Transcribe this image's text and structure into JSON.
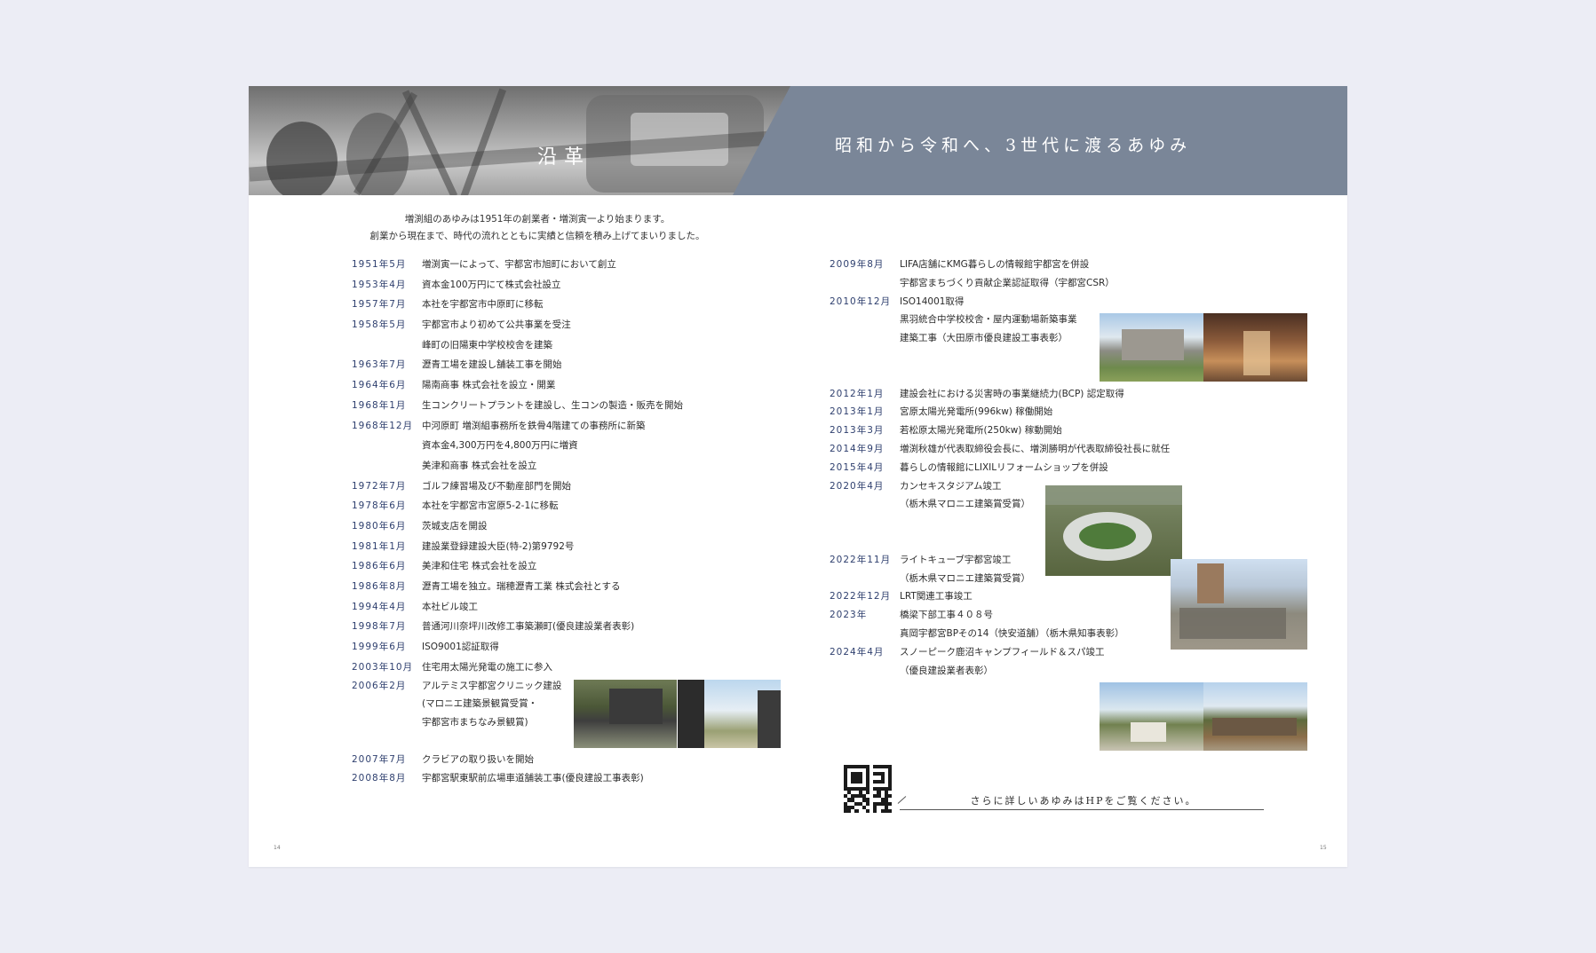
{
  "header": {
    "section_title": "沿革",
    "tagline": "昭和から令和へ、3世代に渡るあゆみ"
  },
  "intro": {
    "line1": "増渕組のあゆみは1951年の創業者・増渕寅一より始まります。",
    "line2": "創業から現在まで、時代の流れとともに実績と信頼を積み上げてまいりました。"
  },
  "left_timeline": [
    {
      "date": "1951年5月",
      "text": "増渕寅一によって、宇都宮市旭町において創立"
    },
    {
      "date": "1953年4月",
      "text": "資本金100万円にて株式会社設立"
    },
    {
      "date": "1957年7月",
      "text": "本社を宇都宮市中原町に移転"
    },
    {
      "date": "1958年5月",
      "text": "宇都宮市より初めて公共事業を受注"
    },
    {
      "date": "",
      "text": "峰町の旧陽東中学校校舎を建築"
    },
    {
      "date": "1963年7月",
      "text": "瀝青工場を建設し舗装工事を開始"
    },
    {
      "date": "1964年6月",
      "text": "陽南商事 株式会社を設立・開業"
    },
    {
      "date": "1968年1月",
      "text": "生コンクリートプラントを建設し、生コンの製造・販売を開始"
    },
    {
      "date": "1968年12月",
      "text": "中河原町 増渕組事務所を鉄骨4階建ての事務所に新築"
    },
    {
      "date": "",
      "text": "資本金4,300万円を4,800万円に増資"
    },
    {
      "date": "",
      "text": "美津和商事 株式会社を設立"
    },
    {
      "date": "1972年7月",
      "text": "ゴルフ練習場及び不動産部門を開始"
    },
    {
      "date": "1978年6月",
      "text": "本社を宇都宮市宮原5-2-1に移転"
    },
    {
      "date": "1980年6月",
      "text": "茨城支店を開設"
    },
    {
      "date": "1981年1月",
      "text": "建設業登録建設大臣(特-2)第9792号"
    },
    {
      "date": "1986年6月",
      "text": "美津和住宅 株式会社を設立"
    },
    {
      "date": "1986年8月",
      "text": "瀝青工場を独立。瑞穂瀝青工業 株式会社とする"
    },
    {
      "date": "1994年4月",
      "text": "本社ビル竣工"
    },
    {
      "date": "1998年7月",
      "text": "普通河川奈坪川改修工事築瀬町(優良建設業者表彰)"
    },
    {
      "date": "1999年6月",
      "text": "ISO9001認証取得"
    },
    {
      "date": "2003年10月",
      "text": "住宅用太陽光発電の施工に参入"
    },
    {
      "date": "2006年2月",
      "text": "アルテミス宇都宮クリニック建設"
    },
    {
      "date": "",
      "text": "(マロニエ建築景観賞受賞・"
    },
    {
      "date": "",
      "text": "宇都宮市まちなみ景観賞)"
    },
    {
      "date": "",
      "text": ""
    },
    {
      "date": "2007年7月",
      "text": "クラビアの取り扱いを開始"
    },
    {
      "date": "2008年8月",
      "text": "宇都宮駅東駅前広場車道舗装工事(優良建設工事表彰)"
    }
  ],
  "right_timeline": [
    {
      "date": "2009年8月",
      "text": "LIFA店舗にKMG暮らしの情報館宇都宮を併設"
    },
    {
      "date": "",
      "text": "宇都宮まちづくり貢献企業認証取得（宇都宮CSR）"
    },
    {
      "date": "2010年12月",
      "text": "ISO14001取得"
    },
    {
      "date": "",
      "text": "黒羽統合中学校校舎・屋内運動場新築事業"
    },
    {
      "date": "",
      "text": "建築工事（大田原市優良建設工事表彰）"
    },
    {
      "date": "",
      "text": ""
    },
    {
      "date": "",
      "text": ""
    },
    {
      "date": "2012年1月",
      "text": "建設会社における災害時の事業継続力(BCP) 認定取得"
    },
    {
      "date": "2013年1月",
      "text": "宮原太陽光発電所(996kw) 稼働開始"
    },
    {
      "date": "2013年3月",
      "text": "若松原太陽光発電所(250kw) 稼動開始"
    },
    {
      "date": "2014年9月",
      "text": "増渕秋雄が代表取締役会長に、増渕勝明が代表取締役社長に就任"
    },
    {
      "date": "2015年4月",
      "text": "暮らしの情報館にLIXILリフォームショップを併設"
    },
    {
      "date": "2020年4月",
      "text": "カンセキスタジアム竣工"
    },
    {
      "date": "",
      "text": "（栃木県マロニエ建築賞受賞）"
    },
    {
      "date": "",
      "text": ""
    },
    {
      "date": "",
      "text": ""
    },
    {
      "date": "2022年11月",
      "text": "ライトキューブ宇都宮竣工"
    },
    {
      "date": "",
      "text": "（栃木県マロニエ建築賞受賞）"
    },
    {
      "date": "2022年12月",
      "text": "LRT関連工事竣工"
    },
    {
      "date": "2023年",
      "text": "橋梁下部工事４０８号"
    },
    {
      "date": "",
      "text": "真岡宇都宮BPその14（快安道舗）（栃木県知事表彰）"
    },
    {
      "date": "2024年4月",
      "text": "スノーピーク鹿沼キャンプフィールド＆スパ竣工"
    },
    {
      "date": "",
      "text": "（優良建設業者表彰）"
    }
  ],
  "hp_note": "さらに詳しいあゆみはHPをご覧ください。",
  "page_numbers": {
    "left": "14",
    "right": "15"
  },
  "colors": {
    "band": "#7a8698",
    "date": "#2e3f6e",
    "background": "#ecedf5"
  }
}
